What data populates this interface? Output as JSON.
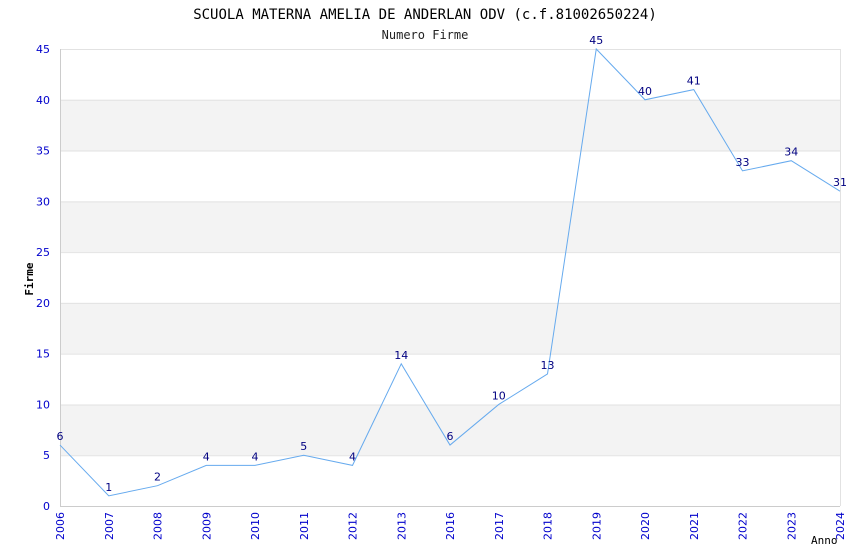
{
  "chart_data": {
    "type": "line",
    "title": "SCUOLA MATERNA AMELIA DE ANDERLAN ODV (c.f.81002650224)",
    "subtitle": "Numero Firme",
    "xlabel": "Anno",
    "ylabel": "Firme",
    "categories": [
      "2006",
      "2007",
      "2008",
      "2009",
      "2010",
      "2011",
      "2012",
      "2013",
      "2016",
      "2017",
      "2018",
      "2019",
      "2020",
      "2021",
      "2022",
      "2023",
      "2024"
    ],
    "series": [
      {
        "values": [
          6,
          1,
          2,
          4,
          4,
          5,
          4,
          14,
          6,
          10,
          13,
          45,
          40,
          41,
          33,
          34,
          31
        ]
      }
    ],
    "ylim": [
      0,
      45
    ],
    "yticks": [
      0,
      5,
      10,
      15,
      20,
      25,
      30,
      35,
      40,
      45
    ],
    "grid": "horizontal alternating bands",
    "colors": {
      "line": "#66aaee",
      "band": "#f3f3f3",
      "tick": "#0000cc",
      "label": "#000080"
    }
  }
}
